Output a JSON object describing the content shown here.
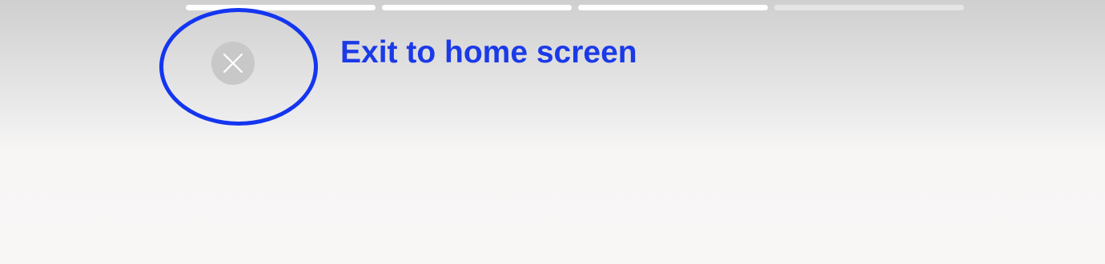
{
  "story": {
    "progress": {
      "segments_total": 4,
      "segments_completed": 3
    },
    "close_button": {
      "icon": "close-icon"
    }
  },
  "annotation": {
    "text": "Exit to home screen",
    "color": "#1a3ae8",
    "highlight_color": "#1436f0"
  }
}
